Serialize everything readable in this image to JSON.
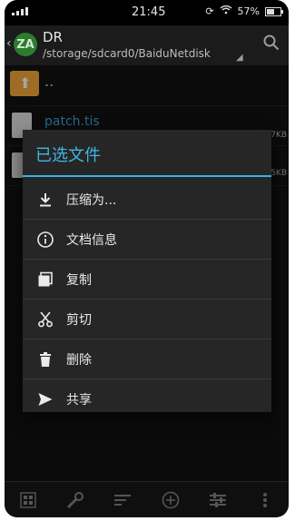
{
  "status_bar": {
    "time": "21:45",
    "battery": "57%"
  },
  "action_bar": {
    "title": "DR",
    "path": "/storage/sdcard0/BaiduNetdisk",
    "logo_text": "ZA"
  },
  "file_list": {
    "up_label": "..",
    "items": [
      {
        "name": "patch.tis",
        "size": "7KB"
      },
      {
        "name": "",
        "size": "5KB"
      }
    ]
  },
  "dialog": {
    "title": "已选文件",
    "items": [
      {
        "icon": "download-icon",
        "label": "压缩为..."
      },
      {
        "icon": "info-icon",
        "label": "文档信息"
      },
      {
        "icon": "copy-icon",
        "label": "复制"
      },
      {
        "icon": "scissors-icon",
        "label": "剪切"
      },
      {
        "icon": "trash-icon",
        "label": "删除"
      },
      {
        "icon": "share-icon",
        "label": "共享"
      }
    ]
  },
  "bottom_bar": {
    "icons": [
      "grid-icon",
      "wrench-icon",
      "sort-icon",
      "add-circle-icon",
      "sliders-icon",
      "more-vertical-icon"
    ]
  },
  "colors": {
    "accent": "#33b5e5",
    "folder": "#f4a63a",
    "background": "#121212",
    "dialog": "#262626"
  }
}
